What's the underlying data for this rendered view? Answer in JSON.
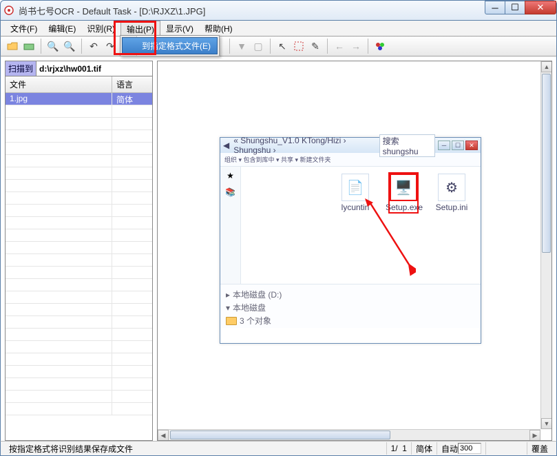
{
  "title": "尚书七号OCR - Default Task - [D:\\RJXZ\\1.JPG]",
  "menus": {
    "file": "文件(F)",
    "edit": "编辑(E)",
    "recognize": "识别(R)",
    "output": "输出(P)",
    "view": "显示(V)",
    "help": "帮助(H)"
  },
  "dropdown": {
    "export_format": "到指定格式文件(E)"
  },
  "sidebar": {
    "scan_label": "扫描到",
    "scan_path": "d:\\rjxz\\hw001.tif",
    "col_file": "文件",
    "col_lang": "语言",
    "rows": [
      {
        "file": "1.jpg",
        "lang": "简体"
      }
    ]
  },
  "explorer": {
    "breadcrumb": "« Shungshu_V1.0 KTong/Hizi › Shungshu ›",
    "search_placeholder": "搜索 shungshu",
    "toolbar": "组织 ▾   包含到库中 ▾   共享 ▾   新建文件夹",
    "files": [
      {
        "name": "lycuntin"
      },
      {
        "name": "Setup.exe"
      },
      {
        "name": "Setup.ini"
      }
    ],
    "bottom_line1": "本地磁盘 (D:)",
    "bottom_line2": "本地磁盘",
    "bottom_line3": "3 个对象"
  },
  "statusbar": {
    "hint": "按指定格式将识别结果保存成文件",
    "page_cur": "1/",
    "page_total": "1",
    "lang_short": "简体",
    "auto_label": "自动",
    "zoom": "300",
    "overwrite": "覆盖"
  }
}
